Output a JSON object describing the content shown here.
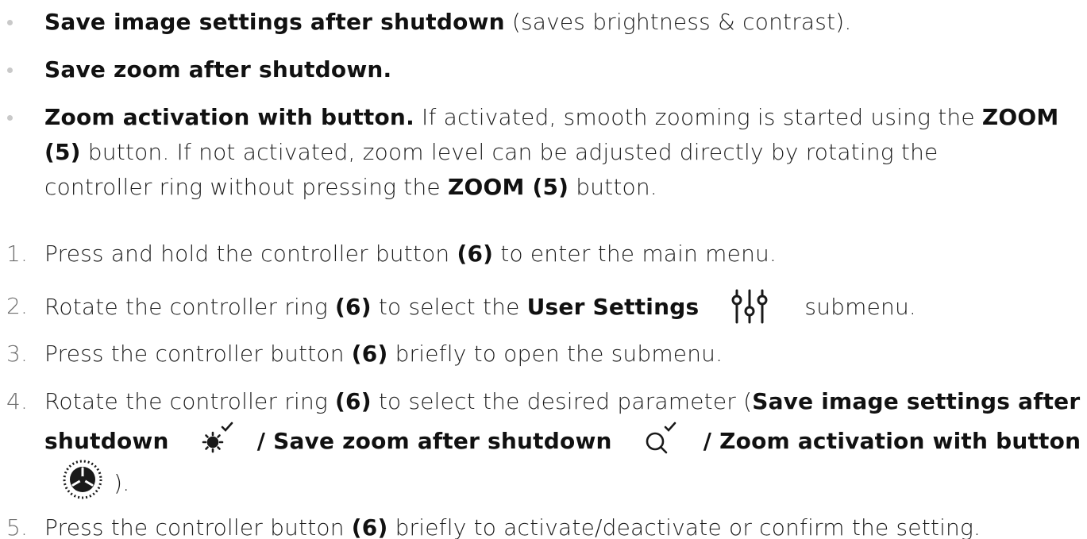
{
  "bullets": [
    {
      "bold": "Save image settings after shutdown",
      "rest": " (saves brightness & contrast)."
    },
    {
      "bold": "Save zoom after shutdown.",
      "rest": ""
    },
    {
      "bold": "Zoom activation with button.",
      "line1_rest": " If activated, smooth zooming is started using the ",
      "line1_bold": "ZOOM",
      "line2_bold": "(5)",
      "line2_rest": " button. If not activated, zoom level can be adjusted directly by rotating the",
      "line3_text": "controller ring without pressing the ",
      "line3_bold": "ZOOM (5)",
      "line3_end": " button."
    }
  ],
  "steps": [
    {
      "num": "1.",
      "a": "Press and hold the controller button ",
      "b": "(6)",
      "c": " to enter the main menu."
    },
    {
      "num": "2.",
      "a": "Rotate the controller ring ",
      "b": "(6)",
      "c": " to select the ",
      "d": "User Settings",
      "icon": "sliders-icon",
      "e": "submenu."
    },
    {
      "num": "3.",
      "a": "Press the controller button ",
      "b": "(6)",
      "c": " briefly to open the submenu."
    },
    {
      "num": "4.",
      "a": "Rotate the controller ring ",
      "b": "(6)",
      "c": " to select the desired parameter (",
      "d": "Save image settings after",
      "line2_a": "shutdown",
      "icon1": "brightness-check-icon",
      "line2_b": "/ Save zoom after shutdown",
      "icon2": "zoom-check-icon",
      "line2_c": "/ Zoom activation with button",
      "icon3": "controller-ring-icon",
      "line3_end": " )."
    },
    {
      "num": "5.",
      "a": "Press the controller button ",
      "b": "(6)",
      "c": " briefly to activate/deactivate or confirm the setting."
    }
  ]
}
